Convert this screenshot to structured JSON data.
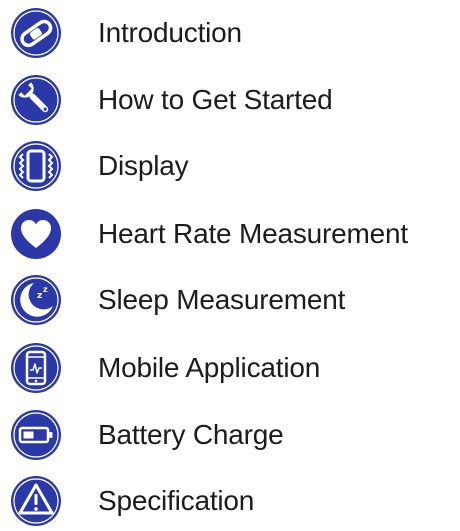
{
  "accent_color": "#2a38a8",
  "toc": {
    "items": [
      {
        "label": "Introduction",
        "icon": "bracelet-icon"
      },
      {
        "label": "How to Get Started",
        "icon": "wrench-icon"
      },
      {
        "label": "Display",
        "icon": "vibrating-phone-icon"
      },
      {
        "label": "Heart Rate Measurement",
        "icon": "heart-icon"
      },
      {
        "label": "Sleep Measurement",
        "icon": "moon-sleep-icon"
      },
      {
        "label": "Mobile Application",
        "icon": "smartphone-icon"
      },
      {
        "label": "Battery Charge",
        "icon": "battery-icon"
      },
      {
        "label": "Specification",
        "icon": "warning-icon"
      }
    ]
  }
}
